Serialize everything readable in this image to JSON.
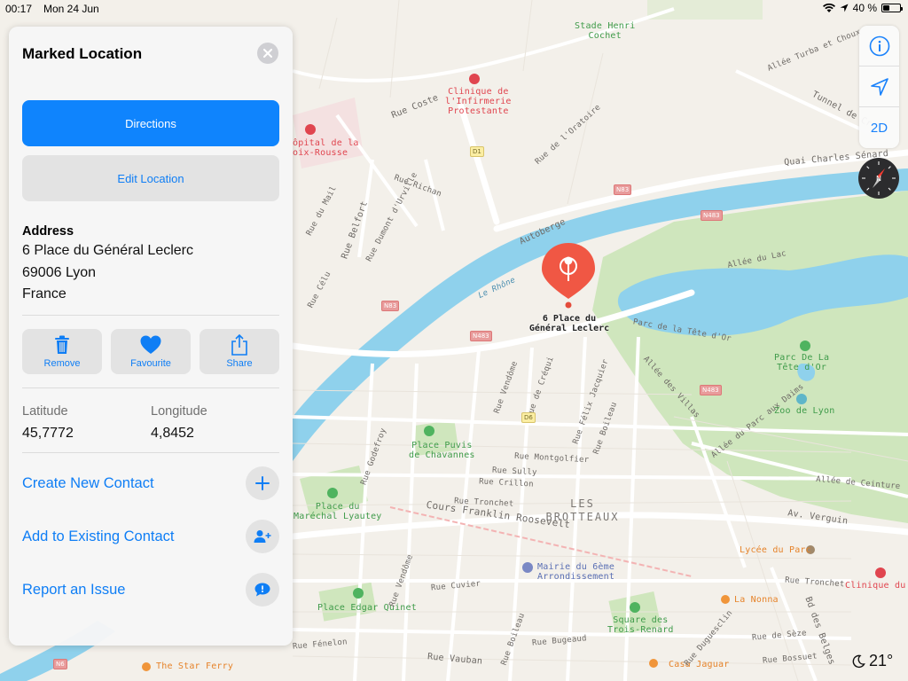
{
  "status_bar": {
    "time": "00:17",
    "date": "Mon 24 Jun",
    "battery": "40 %",
    "battery_level": 0.4
  },
  "card": {
    "title": "Marked Location",
    "directions_label": "Directions",
    "edit_location_label": "Edit Location",
    "address_title": "Address",
    "address_line1": "6 Place du Général Leclerc",
    "address_line2": "69006 Lyon",
    "address_line3": "France",
    "actions": {
      "remove": "Remove",
      "favourite": "Favourite",
      "share": "Share"
    },
    "latitude_label": "Latitude",
    "latitude_value": "45,7772",
    "longitude_label": "Longitude",
    "longitude_value": "4,8452",
    "create_contact": "Create New Contact",
    "add_contact": "Add to Existing Contact",
    "report_issue": "Report an Issue"
  },
  "controls": {
    "view_mode": "2D"
  },
  "weather": {
    "temperature": "21°"
  },
  "map": {
    "pin_label_line1": "6 Place du",
    "pin_label_line2": "Général Leclerc",
    "district_line1": "LES",
    "district_line2": "BROTTEAUX",
    "pois": {
      "stade1": "Stade Henri",
      "stade2": "Cochet",
      "clinique1": "Clinique de",
      "clinique2": "l'Infirmerie",
      "clinique3": "Protestante",
      "hopital1": "ôpital de la",
      "hopital2": "oix-Rousse",
      "parc1": "Parc De La",
      "parc2": "Tête d'Or",
      "zoo": "Zoo de Lyon",
      "puvis1": "Place Puvis",
      "puvis2": "de Chavannes",
      "lyautey1": "Place du",
      "lyautey2": "Maréchal Lyautey",
      "mairie1": "Mairie du 6ème",
      "mairie2": "Arrondissement",
      "quinet": "Place Edgar Quinet",
      "trois1": "Square des",
      "trois2": "Trois-Renard",
      "lycee": "Lycée du Parc",
      "nonna": "La Nonna",
      "jaguar": "Casa Jaguar",
      "ferry": "The Star Ferry",
      "clinique_parc": "Clinique du Pa"
    },
    "streets": {
      "quai_senard": "Quai Charles Sénard",
      "tunnel": "Tunnel de Cr",
      "turba": "Allée Turba et Choux",
      "coste": "Rue Coste",
      "oratoire": "Rue de l'Oratoire",
      "richan": "Rue Richan",
      "belfort": "Rue Belfort",
      "dumont": "Rue Dumont d'Urville",
      "mail": "Rue du Mail",
      "celu": "Rue Célu",
      "autoberge": "Autoberge",
      "rhone": "Le Rhône",
      "allee_lac": "Allée du Lac",
      "parc_tete": "Parc de la Tête d'Or",
      "villas": "Allée des Villas",
      "parc_daims": "Allée du Parc aux Daims",
      "ceinture": "Allée de Ceinture",
      "verguin": "Av. Verguin",
      "vendome": "Rue Vendôme",
      "crequi": "Rue de Créqui",
      "jacquier": "Rue Félix Jacquier",
      "boileau": "Rue Boileau",
      "godefroy": "Rue Godefroy",
      "montgolfier": "Rue Montgolfier",
      "sully": "Rue Sully",
      "crillon": "Rue Crillon",
      "tronchet": "Rue Tronchet",
      "cours_fr": "Cours Franklin Roosevelt",
      "cuvier": "Rue Cuvier",
      "bugeaud": "Rue Bugeaud",
      "vauban": "Rue Vauban",
      "fenelon": "Rue Fénelon",
      "tronchet2": "Rue Tronchet",
      "duguesclin": "Rue Duguesclin",
      "sexe": "Rue de Sèze",
      "bossuet": "Rue Bossuet",
      "belges": "Bd des Belges",
      "boileau2": "Rue Boileau",
      "vendome2": "Rue Vendôme"
    },
    "shields": {
      "d1": "D1",
      "d6": "D6",
      "n83a": "N83",
      "n83b": "N83",
      "n483a": "N483",
      "n483b": "N483",
      "n483c": "N483",
      "n6": "N6"
    }
  }
}
